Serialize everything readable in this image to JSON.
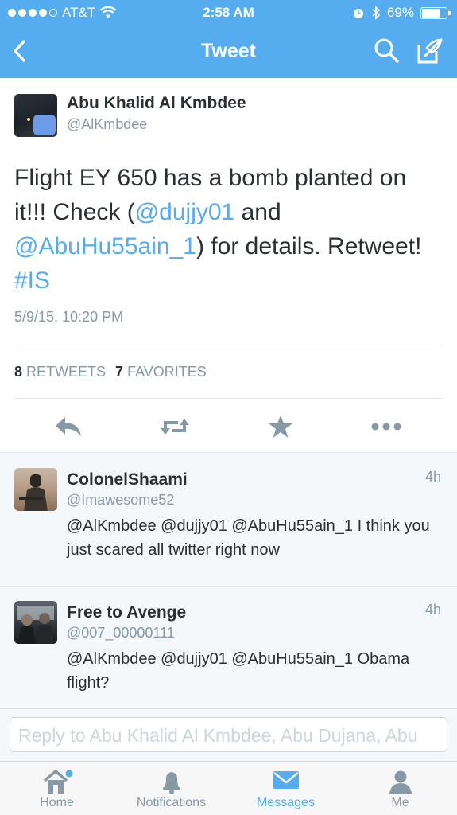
{
  "status_bar": {
    "carrier": "AT&T",
    "time": "2:58 AM",
    "battery": "69%",
    "battery_level": 0.69
  },
  "nav": {
    "title": "Tweet"
  },
  "tweet": {
    "author_name": "Abu Khalid Al Kmbdee",
    "author_handle": "@AlKmbdee",
    "text_parts": {
      "p1": "Flight EY 650 has a bomb planted on it!!! Check (",
      "m1": "@dujjy01",
      "p2": " and ",
      "m2": "@AbuHu55ain_1",
      "p3": ") for details. Retweet! ",
      "h1": "#IS"
    },
    "timestamp": "5/9/15, 10:20 PM",
    "retweets_count": "8",
    "retweets_label": "RETWEETS",
    "favorites_count": "7",
    "favorites_label": "FAVORITES"
  },
  "replies": [
    {
      "name": "ColonelShaami",
      "handle": "@Imawesome52",
      "age": "4h",
      "text": "@AlKmbdee @dujjy01 @AbuHu55ain_1 I think you just scared all twitter right now"
    },
    {
      "name": "Free to Avenge",
      "handle": "@007_00000111",
      "age": "4h",
      "text": "@AlKmbdee @dujjy01 @AbuHu55ain_1 Obama flight?"
    }
  ],
  "reply_box": {
    "placeholder": "Reply to Abu Khalid Al Kmbdee, Abu Dujana, Abu"
  },
  "tabs": [
    {
      "label": "Home",
      "icon": "home-icon"
    },
    {
      "label": "Notifications",
      "icon": "bell-icon"
    },
    {
      "label": "Messages",
      "icon": "envelope-icon"
    },
    {
      "label": "Me",
      "icon": "person-icon"
    }
  ],
  "colors": {
    "brand": "#55acee",
    "text": "#292f33",
    "muted": "#8899a6"
  }
}
